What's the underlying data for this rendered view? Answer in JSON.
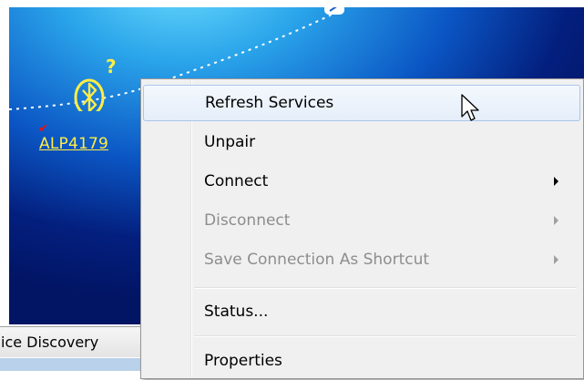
{
  "device": {
    "name": "ALP4179",
    "status_mark": "✔",
    "icon": "bluetooth-icon",
    "badge_icon": "question-icon"
  },
  "status_tab": {
    "label": "ice Discovery"
  },
  "context_menu": {
    "items": [
      {
        "label": "Refresh Services",
        "state": "hovered",
        "submenu": false
      },
      {
        "label": "Unpair",
        "state": "enabled",
        "submenu": false
      },
      {
        "label": "Connect",
        "state": "enabled",
        "submenu": true
      },
      {
        "label": "Disconnect",
        "state": "disabled",
        "submenu": true
      },
      {
        "label": "Save Connection As Shortcut",
        "state": "disabled",
        "submenu": true
      },
      {
        "label": "Status...",
        "state": "enabled",
        "submenu": false
      },
      {
        "label": "Properties",
        "state": "enabled",
        "submenu": false
      }
    ]
  },
  "colors": {
    "device_label": "#ffee44",
    "menu_background": "#f0f0f0",
    "menu_hover_border": "#a8c6ec",
    "disabled_text": "#8d8d8d"
  }
}
